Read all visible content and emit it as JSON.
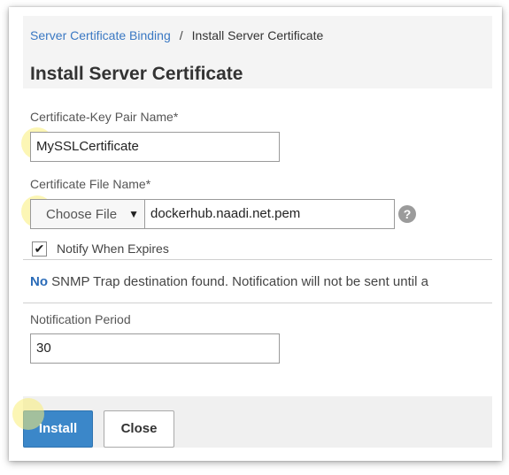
{
  "breadcrumb": {
    "parent": "Server Certificate Binding",
    "separator": "/",
    "current": "Install Server Certificate"
  },
  "page_title": "Install Server Certificate",
  "cert_key_pair": {
    "label": "Certificate-Key Pair Name*",
    "value": "MySSLCertificate"
  },
  "cert_file": {
    "label": "Certificate File Name*",
    "choose_label": "Choose File",
    "caret": "▼",
    "value": "dockerhub.naadi.net.pem",
    "help_glyph": "?"
  },
  "notify": {
    "label": "Notify When Expires",
    "checked": true,
    "check_glyph": "✔"
  },
  "notice": {
    "emphasis": "No",
    "text": " SNMP Trap destination found. Notification will not be sent until a"
  },
  "notification_period": {
    "label": "Notification Period",
    "value": "30"
  },
  "buttons": {
    "install": "Install",
    "close": "Close"
  },
  "colors": {
    "accent": "#3b87c9",
    "link": "#3a78c3",
    "highlight": "#faee78"
  }
}
